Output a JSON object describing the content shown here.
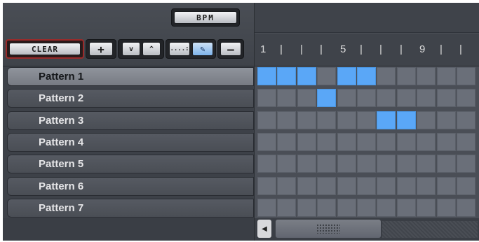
{
  "toolbar": {
    "bpm_label": "BPM",
    "clear_label": "CLEAR",
    "add_label": "+",
    "move_down_label": "v",
    "move_up_label": "^",
    "dots_mode_label": "....:",
    "pencil_mode_label": "✎",
    "remove_label": "—"
  },
  "patterns": [
    {
      "label": "Pattern 1",
      "selected": true
    },
    {
      "label": "Pattern 2",
      "selected": false
    },
    {
      "label": "Pattern 3",
      "selected": false
    },
    {
      "label": "Pattern 4",
      "selected": false
    },
    {
      "label": "Pattern 5",
      "selected": false
    },
    {
      "label": "Pattern 6",
      "selected": false
    },
    {
      "label": "Pattern 7",
      "selected": false
    }
  ],
  "ruler": {
    "marks": [
      "1",
      "|",
      "|",
      "|",
      "5",
      "|",
      "|",
      "|",
      "9",
      "|",
      "|"
    ]
  },
  "grid": {
    "visible_columns": 11,
    "active_cells": [
      [
        1,
        1,
        1,
        0,
        1,
        1,
        0,
        0,
        0,
        0,
        0
      ],
      [
        0,
        0,
        0,
        1,
        0,
        0,
        0,
        0,
        0,
        0,
        0
      ],
      [
        0,
        0,
        0,
        0,
        0,
        0,
        1,
        1,
        0,
        0,
        0
      ],
      [
        0,
        0,
        0,
        0,
        0,
        0,
        0,
        0,
        0,
        0,
        0
      ],
      [
        0,
        0,
        0,
        0,
        0,
        0,
        0,
        0,
        0,
        0,
        0
      ],
      [
        0,
        0,
        0,
        0,
        0,
        0,
        0,
        0,
        0,
        0,
        0
      ],
      [
        0,
        0,
        0,
        0,
        0,
        0,
        0,
        0,
        0,
        0,
        0
      ]
    ]
  },
  "scrollbar": {
    "left_arrow": "◀"
  },
  "colors": {
    "active_cell": "#5aa7f7",
    "inactive_cell": "#6a6f79",
    "clear_border": "#9a2a2a"
  }
}
